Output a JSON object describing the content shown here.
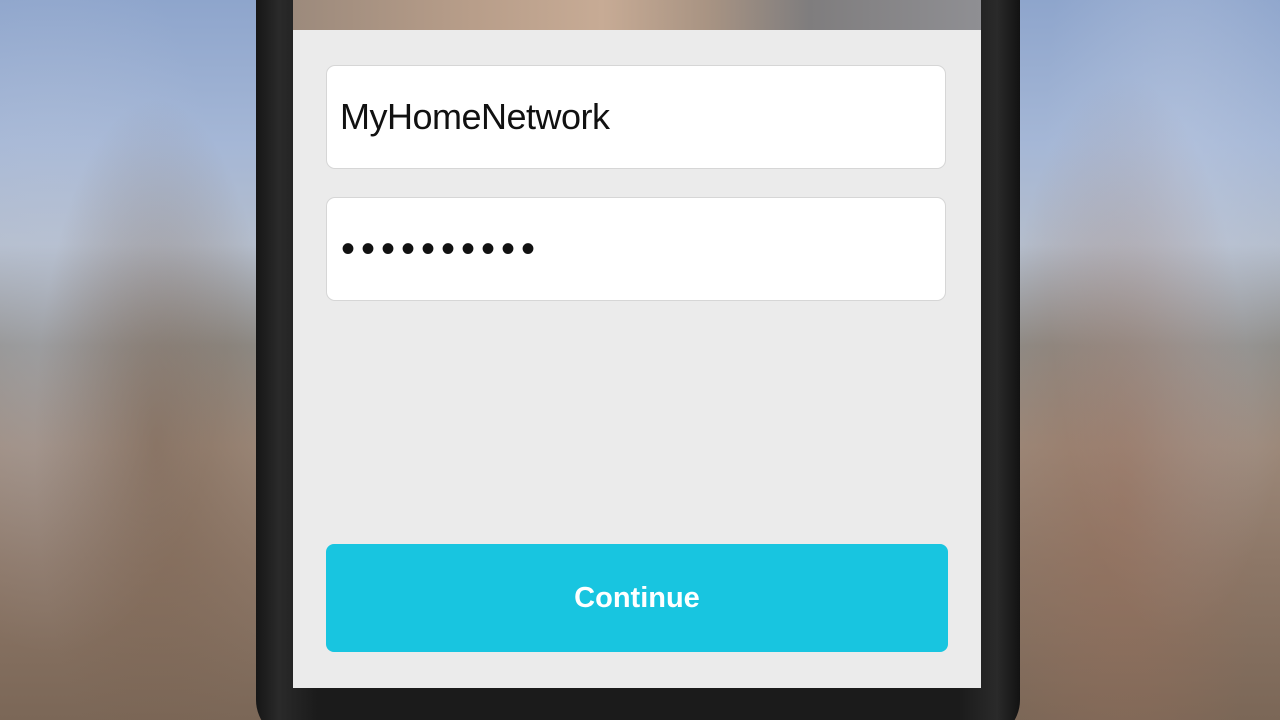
{
  "form": {
    "network_name_value": "MyHomeNetwork",
    "password_value": "••••••••••",
    "continue_label": "Continue"
  },
  "colors": {
    "accent": "#18c5e0",
    "screen_background": "#ebebeb",
    "field_background": "#ffffff"
  }
}
